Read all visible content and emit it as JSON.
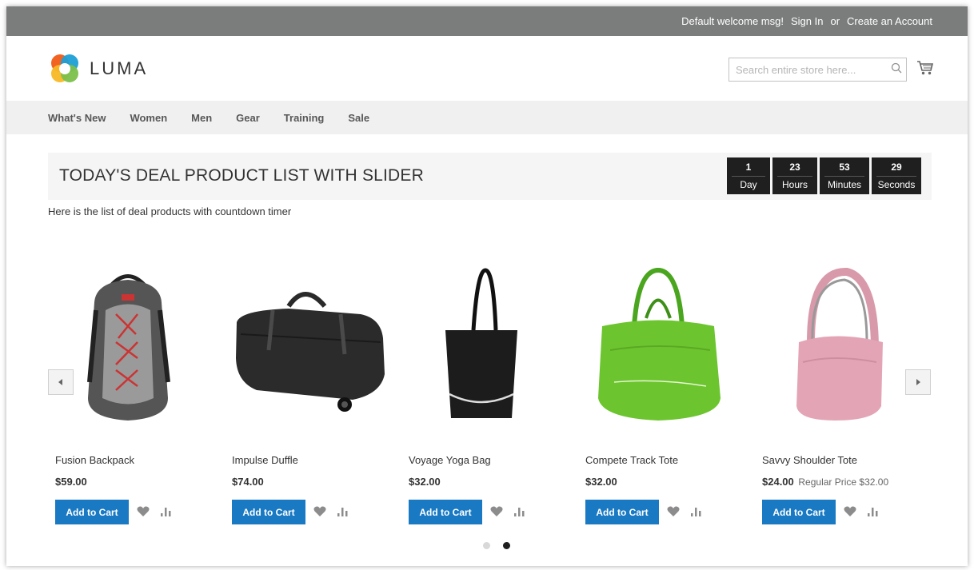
{
  "topbar": {
    "welcome": "Default welcome msg!",
    "sign_in": "Sign In",
    "or": "or",
    "create_account": "Create an Account"
  },
  "header": {
    "logo_text": "LUMA",
    "search_placeholder": "Search entire store here...",
    "icons": [
      "search-icon",
      "cart-icon"
    ]
  },
  "nav": {
    "items": [
      "What's New",
      "Women",
      "Men",
      "Gear",
      "Training",
      "Sale"
    ]
  },
  "deal": {
    "title": "TODAY'S DEAL PRODUCT LIST WITH SLIDER",
    "subtitle": "Here is the list of deal products with countdown timer",
    "timer": [
      {
        "value": "1",
        "label": "Day"
      },
      {
        "value": "23",
        "label": "Hours"
      },
      {
        "value": "53",
        "label": "Minutes"
      },
      {
        "value": "29",
        "label": "Seconds"
      }
    ]
  },
  "products": [
    {
      "name": "Fusion Backpack",
      "price": "$59.00",
      "regular": "",
      "add_label": "Add to Cart"
    },
    {
      "name": "Impulse Duffle",
      "price": "$74.00",
      "regular": "",
      "add_label": "Add to Cart"
    },
    {
      "name": "Voyage Yoga Bag",
      "price": "$32.00",
      "regular": "",
      "add_label": "Add to Cart"
    },
    {
      "name": "Compete Track Tote",
      "price": "$32.00",
      "regular": "",
      "add_label": "Add to Cart"
    },
    {
      "name": "Savvy Shoulder Tote",
      "price": "$24.00",
      "regular": "Regular Price $32.00",
      "add_label": "Add to Cart"
    }
  ],
  "pager": {
    "active": 2,
    "total": 2
  },
  "colors": {
    "topbar": "#7b7d7c",
    "nav_bg": "#f0f0f0",
    "primary_button": "#1979c3",
    "timer_bg": "#1f1f1f"
  }
}
